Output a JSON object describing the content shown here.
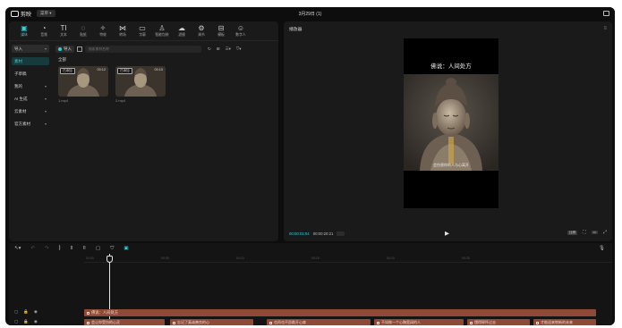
{
  "titlebar": {
    "app_name": "剪映",
    "menu_label": "菜单",
    "window_title": "3月29日 (1)"
  },
  "media_tools": [
    {
      "label": "媒体",
      "glyph": "▣",
      "icon": "media-icon"
    },
    {
      "label": "音频",
      "glyph": "◔",
      "icon": "audio-icon"
    },
    {
      "label": "文本",
      "glyph": "TI",
      "icon": "text-icon"
    },
    {
      "label": "贴纸",
      "glyph": "◌",
      "icon": "sticker-icon"
    },
    {
      "label": "特效",
      "glyph": "✧",
      "icon": "effects-icon"
    },
    {
      "label": "转场",
      "glyph": "⋈",
      "icon": "transition-icon"
    },
    {
      "label": "字幕",
      "glyph": "▭",
      "icon": "caption-icon"
    },
    {
      "label": "智能包装",
      "glyph": "♙",
      "icon": "smart-package-icon"
    },
    {
      "label": "滤镜",
      "glyph": "☁",
      "icon": "filter-icon"
    },
    {
      "label": "调节",
      "glyph": "⚙",
      "icon": "adjust-icon"
    },
    {
      "label": "模板",
      "glyph": "⊟",
      "icon": "template-icon"
    },
    {
      "label": "数字人",
      "glyph": "☺",
      "icon": "digital-human-icon"
    }
  ],
  "sidebar": {
    "import_label": "导入",
    "items": [
      {
        "label": "素材",
        "arrow": ""
      },
      {
        "label": "子草稿",
        "arrow": ""
      },
      {
        "label": "我的",
        "arrow": "▾"
      },
      {
        "label": "AI 生成",
        "arrow": "▾"
      },
      {
        "label": "云素材",
        "arrow": "▾"
      },
      {
        "label": "官方素材",
        "arrow": "▾"
      }
    ]
  },
  "media": {
    "import_button": "导入",
    "search_placeholder": "搜索素材名称",
    "all_label": "全部",
    "clips": [
      {
        "tag": "已添加",
        "duration": "00:12",
        "name": "1.mp4"
      },
      {
        "tag": "已添加",
        "duration": "00:10",
        "name": "2.mp4"
      }
    ]
  },
  "player": {
    "title": "播放器",
    "video_title": "佛说：人间处方",
    "subtitle": "会伤害你的人与心离开",
    "current_time": "00:00:01:04",
    "total_time": "00:00:20:21",
    "ratio_label": "比例"
  },
  "timeline": {
    "ruler_ticks": [
      "00:00",
      "00:05",
      "00:10",
      "00:15",
      "00:20",
      "00:25"
    ],
    "text_track_label": "佛说：人间处方",
    "subtitle_clips": [
      {
        "text": "会让你受伤的心灵"
      },
      {
        "text": "忘记了真诚善良的心"
      },
      {
        "text": "也再也不愿敞开心扉"
      },
      {
        "text": "不如做一个心胸宽阔的人"
      },
      {
        "text": "懂得释怀过去"
      },
      {
        "text": "才能迎来崭新的未来"
      }
    ]
  },
  "colors": {
    "accent": "#2fd0d7",
    "text_clip": "#8f4a37",
    "video_track": "#1e5f62"
  }
}
